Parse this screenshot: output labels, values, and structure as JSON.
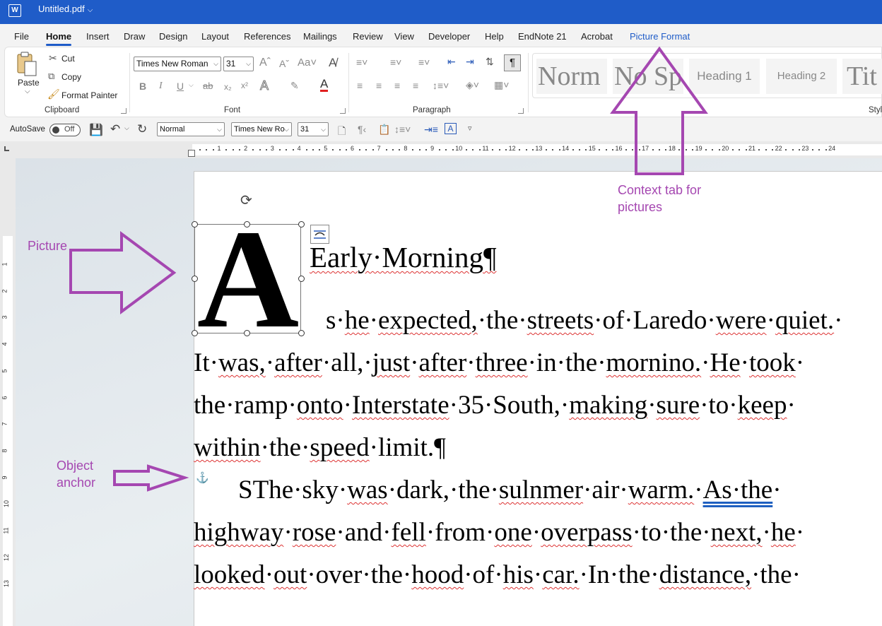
{
  "titlebar": {
    "app_icon": "word-icon",
    "title": "Untitled.pdf"
  },
  "tabs": [
    {
      "label": "File"
    },
    {
      "label": "Home"
    },
    {
      "label": "Insert"
    },
    {
      "label": "Draw"
    },
    {
      "label": "Design"
    },
    {
      "label": "Layout"
    },
    {
      "label": "References"
    },
    {
      "label": "Mailings"
    },
    {
      "label": "Review"
    },
    {
      "label": "View"
    },
    {
      "label": "Developer"
    },
    {
      "label": "Help"
    },
    {
      "label": "EndNote 21"
    },
    {
      "label": "Acrobat"
    },
    {
      "label": "Picture Format"
    }
  ],
  "ribbon": {
    "clipboard": {
      "paste": "Paste",
      "cut": "Cut",
      "copy": "Copy",
      "format_painter": "Format Painter",
      "label": "Clipboard"
    },
    "font": {
      "font_name": "Times New Roman",
      "font_size": "31",
      "label": "Font"
    },
    "paragraph": {
      "label": "Paragraph"
    },
    "styles": {
      "items": [
        "Norm",
        "No Sp",
        "Heading 1",
        "Heading 2",
        "Tit"
      ],
      "label": "Styl"
    }
  },
  "qat": {
    "autosave": "AutoSave",
    "toggle": "Off",
    "style": "Normal",
    "font": "Times New Ro",
    "size": "31"
  },
  "ruler": {
    "marks": [
      "1",
      "2",
      "3",
      "4",
      "5",
      "6",
      "7",
      "8",
      "9",
      "10",
      "11",
      "12",
      "13",
      "14",
      "15",
      "16",
      "17",
      "18",
      "19",
      "20",
      "21",
      "22",
      "23",
      "24"
    ],
    "vmarks": [
      "1",
      "2",
      "3",
      "4",
      "5",
      "6",
      "7",
      "8",
      "9",
      "10",
      "11",
      "12",
      "13"
    ]
  },
  "document": {
    "drop_cap": "A",
    "heading": "Early·Morning¶",
    "lines": [
      [
        {
          "t": "s·"
        },
        {
          "t": "he",
          "s": 1
        },
        {
          "t": "·"
        },
        {
          "t": "expected,",
          "s": 1
        },
        {
          "t": "·the·"
        },
        {
          "t": "streets",
          "s": 1
        },
        {
          "t": "·of·Laredo·"
        },
        {
          "t": "were",
          "s": 1
        },
        {
          "t": "·"
        },
        {
          "t": "quiet.",
          "s": 1
        },
        {
          "t": "·"
        }
      ],
      [
        {
          "t": "It·"
        },
        {
          "t": "was,",
          "s": 1
        },
        {
          "t": "·"
        },
        {
          "t": "after",
          "s": 1
        },
        {
          "t": "·all,·"
        },
        {
          "t": "just",
          "s": 1
        },
        {
          "t": "·"
        },
        {
          "t": "after",
          "s": 1
        },
        {
          "t": "·"
        },
        {
          "t": "three",
          "s": 1
        },
        {
          "t": "·in·the·"
        },
        {
          "t": "mornino.",
          "s": 1
        },
        {
          "t": "·"
        },
        {
          "t": "He",
          "s": 1
        },
        {
          "t": "·"
        },
        {
          "t": "took",
          "s": 1
        },
        {
          "t": "·"
        }
      ],
      [
        {
          "t": "the·ramp·"
        },
        {
          "t": "onto",
          "s": 1
        },
        {
          "t": "·"
        },
        {
          "t": "Interstate",
          "s": 1
        },
        {
          "t": "·35·South,·"
        },
        {
          "t": "making",
          "s": 1
        },
        {
          "t": "·"
        },
        {
          "t": "sure",
          "s": 1
        },
        {
          "t": "·to·"
        },
        {
          "t": "keep",
          "s": 1
        },
        {
          "t": "·"
        }
      ],
      [
        {
          "t": "within",
          "s": 1
        },
        {
          "t": "·the·"
        },
        {
          "t": "speed",
          "s": 1
        },
        {
          "t": "·limit.¶"
        }
      ],
      [
        {
          "t": "STh"
        },
        {
          "t": "e·sky·"
        },
        {
          "t": "was",
          "s": 1
        },
        {
          "t": "·dark,·the·"
        },
        {
          "t": "sulnmer",
          "s": 1
        },
        {
          "t": "·air·"
        },
        {
          "t": "warm.",
          "s": 1
        },
        {
          "t": "·"
        },
        {
          "t": "As·the",
          "s": 2
        },
        {
          "t": "·"
        }
      ],
      [
        {
          "t": "highway",
          "s": 1
        },
        {
          "t": "·"
        },
        {
          "t": "rose",
          "s": 1
        },
        {
          "t": "·and·"
        },
        {
          "t": "fell",
          "s": 1
        },
        {
          "t": "·from·"
        },
        {
          "t": "one",
          "s": 1
        },
        {
          "t": "·"
        },
        {
          "t": "overpass",
          "s": 1
        },
        {
          "t": "·to·the·"
        },
        {
          "t": "next,",
          "s": 1
        },
        {
          "t": "·"
        },
        {
          "t": "he",
          "s": 1
        },
        {
          "t": "·"
        }
      ],
      [
        {
          "t": "looked",
          "s": 1
        },
        {
          "t": "·"
        },
        {
          "t": "out",
          "s": 1
        },
        {
          "t": "·over·the·"
        },
        {
          "t": "hood",
          "s": 1
        },
        {
          "t": "·of·"
        },
        {
          "t": "his",
          "s": 1
        },
        {
          "t": "·"
        },
        {
          "t": "car.",
          "s": 1
        },
        {
          "t": "·In·the·"
        },
        {
          "t": "distance,",
          "s": 1
        },
        {
          "t": "·the·"
        }
      ]
    ]
  },
  "annotations": {
    "context_tab": "Context tab for pictures",
    "picture": "Picture",
    "anchor": "Object anchor"
  },
  "colors": {
    "titlebar": "#1f5cc8",
    "annotation": "#a547b1"
  }
}
